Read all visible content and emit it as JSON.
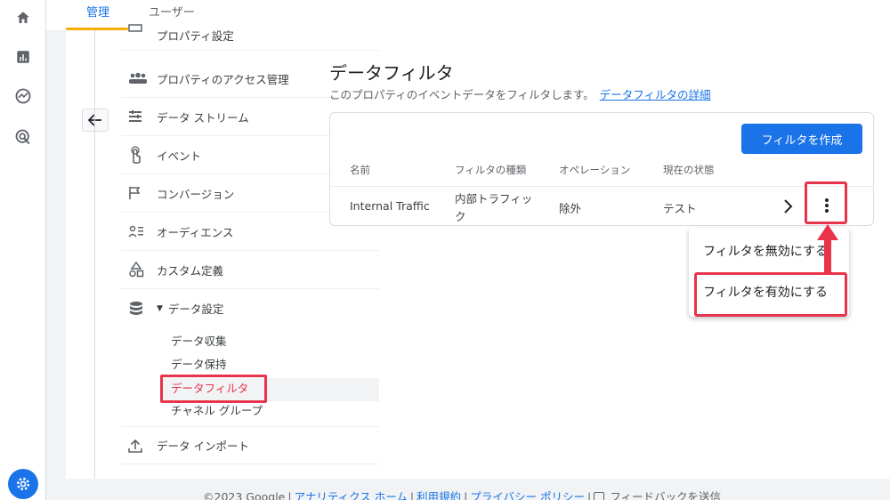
{
  "tabs": [
    {
      "label": "管理",
      "active": true
    },
    {
      "label": "ユーザー",
      "active": false
    }
  ],
  "nav": {
    "items": [
      {
        "label": "プロパティ設定",
        "icon": "property-settings-icon"
      },
      {
        "label": "プロパティのアクセス管理",
        "icon": "people-icon"
      },
      {
        "label": "データ ストリーム",
        "icon": "streams-icon"
      },
      {
        "label": "イベント",
        "icon": "touch-icon"
      },
      {
        "label": "コンバージョン",
        "icon": "flag-icon"
      },
      {
        "label": "オーディエンス",
        "icon": "audience-icon"
      },
      {
        "label": "カスタム定義",
        "icon": "shapes-icon"
      },
      {
        "label": "データ設定",
        "icon": "database-icon"
      },
      {
        "label": "データ インポート",
        "icon": "upload-icon"
      }
    ],
    "sub_items": [
      "データ収集",
      "データ保持",
      "データフィルタ",
      "チャネル グループ"
    ]
  },
  "main": {
    "title": "データフィルタ",
    "description": "このプロパティのイベントデータをフィルタします。",
    "details_link": "データフィルタの詳細",
    "create_button": "フィルタを作成",
    "table": {
      "headers": [
        "名前",
        "フィルタの種類",
        "オペレーション",
        "現在の状態"
      ],
      "rows": [
        {
          "name": "Internal Traffic",
          "type_line1": "内部トラフィッ",
          "type_line2": "ク",
          "operation": "除外",
          "status": "テスト"
        }
      ]
    }
  },
  "menu": {
    "items": [
      "フィルタを無効にする",
      "フィルタを有効にする"
    ]
  },
  "footer": {
    "copyright": "©2023 Google",
    "links": [
      "アナリティクス ホーム",
      "利用規約",
      "プライバシー ポリシー"
    ],
    "feedback": "フィードバックを送信"
  },
  "colors": {
    "accent": "#1a73e8",
    "highlight": "#e8334a",
    "tab_underline": "#f9ab00"
  }
}
